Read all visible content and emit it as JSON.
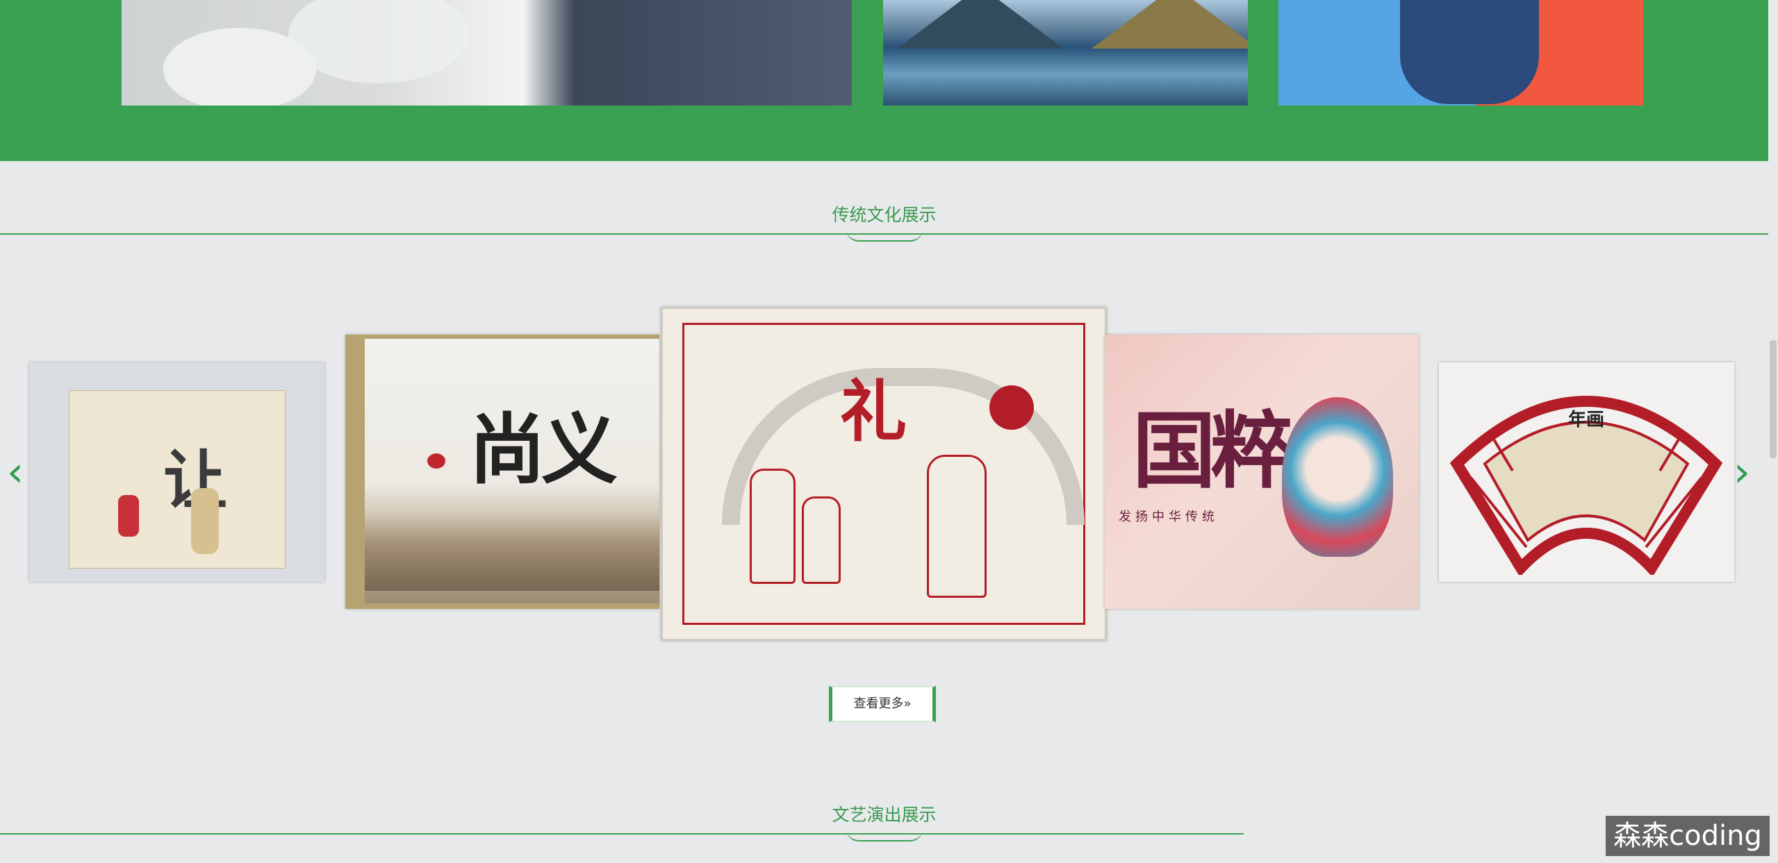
{
  "sections": {
    "culture_title": "传统文化展示",
    "performance_title": "文艺演出展示"
  },
  "cards": [
    {
      "name": "card-rang",
      "big_text": "让"
    },
    {
      "name": "card-shangyi",
      "big_text": "尚义"
    },
    {
      "name": "card-li",
      "big_text": "礼"
    },
    {
      "name": "card-guocui",
      "big_text": "国粹",
      "sub_text": "发扬中华传统"
    },
    {
      "name": "card-nianhua",
      "big_text": "年画"
    }
  ],
  "buttons": {
    "more_label": "查看更多»"
  },
  "icons": {
    "prev": "chevron-left-icon",
    "next": "chevron-right-icon"
  },
  "watermark": "森森coding",
  "colors": {
    "brand_green": "#3ba152",
    "page_bg": "#e8e9ea",
    "accent_red": "#b31d28"
  }
}
